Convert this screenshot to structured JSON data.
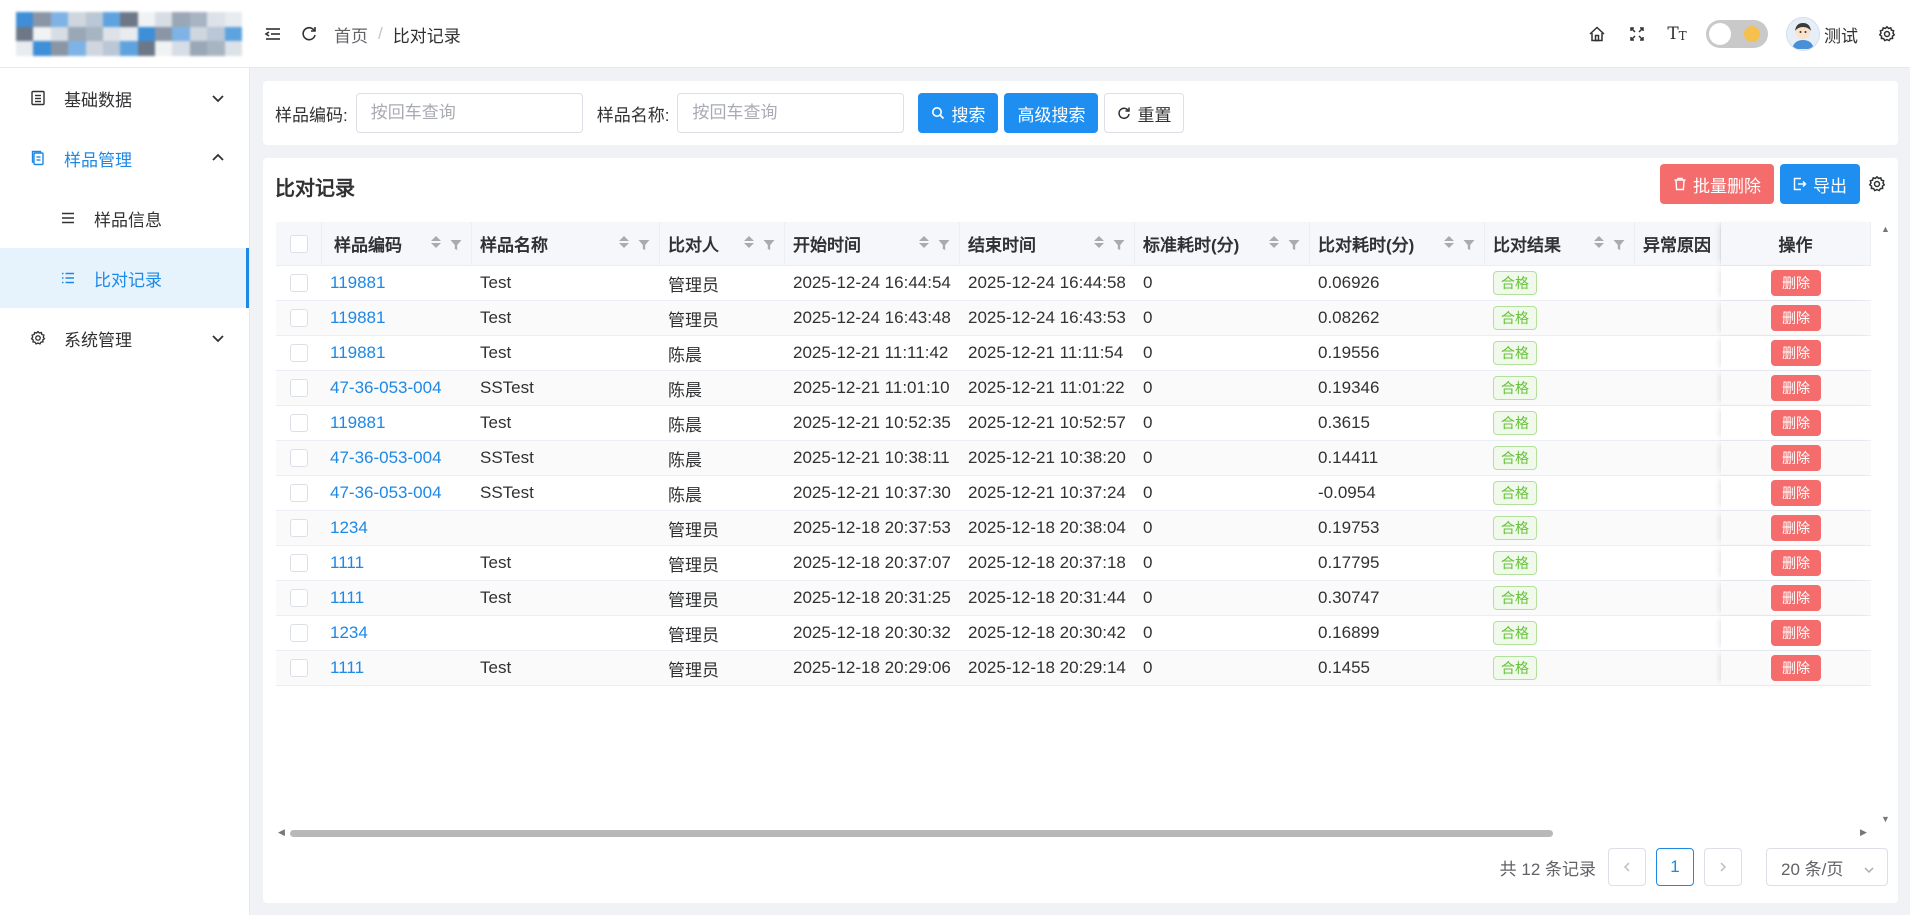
{
  "header": {
    "breadcrumb": [
      "首页",
      "比对记录"
    ],
    "breadcrumb_sep": "/",
    "user_name": "测试",
    "icons": [
      "menu-fold-icon",
      "refresh-icon",
      "home-icon",
      "fullscreen-icon",
      "font-size-icon",
      "theme-toggle",
      "settings-icon"
    ]
  },
  "sidebar": {
    "items": [
      {
        "label": "基础数据",
        "icon": "list-box-icon",
        "expanded": false
      },
      {
        "label": "样品管理",
        "icon": "document-copy-icon",
        "expanded": true,
        "children": [
          {
            "label": "样品信息",
            "icon": "menu-lines-icon"
          },
          {
            "label": "比对记录",
            "icon": "list-icon",
            "active": true
          }
        ]
      },
      {
        "label": "系统管理",
        "icon": "gear-icon",
        "expanded": false
      }
    ]
  },
  "search": {
    "code_label": "样品编码:",
    "code_placeholder": "按回车查询",
    "name_label": "样品名称:",
    "name_placeholder": "按回车查询",
    "search_btn": "搜索",
    "advanced_btn": "高级搜索",
    "reset_btn": "重置"
  },
  "table": {
    "title": "比对记录",
    "batch_delete_btn": "批量删除",
    "export_btn": "导出",
    "columns": [
      "样品编码",
      "样品名称",
      "比对人",
      "开始时间",
      "结束时间",
      "标准耗时(分)",
      "比对耗时(分)",
      "比对结果",
      "异常原因",
      "操作"
    ],
    "delete_label": "删除",
    "rows": [
      {
        "code": "119881",
        "name": "Test",
        "person": "管理员",
        "start": "2025-12-24 16:44:54",
        "end": "2025-12-24 16:44:58",
        "std": "0",
        "cmp": "0.06926",
        "result": "合格",
        "err": ""
      },
      {
        "code": "119881",
        "name": "Test",
        "person": "管理员",
        "start": "2025-12-24 16:43:48",
        "end": "2025-12-24 16:43:53",
        "std": "0",
        "cmp": "0.08262",
        "result": "合格",
        "err": ""
      },
      {
        "code": "119881",
        "name": "Test",
        "person": "陈晨",
        "start": "2025-12-21 11:11:42",
        "end": "2025-12-21 11:11:54",
        "std": "0",
        "cmp": "0.19556",
        "result": "合格",
        "err": ""
      },
      {
        "code": "47-36-053-004",
        "name": "SSTest",
        "person": "陈晨",
        "start": "2025-12-21 11:01:10",
        "end": "2025-12-21 11:01:22",
        "std": "0",
        "cmp": "0.19346",
        "result": "合格",
        "err": ""
      },
      {
        "code": "119881",
        "name": "Test",
        "person": "陈晨",
        "start": "2025-12-21 10:52:35",
        "end": "2025-12-21 10:52:57",
        "std": "0",
        "cmp": "0.3615",
        "result": "合格",
        "err": ""
      },
      {
        "code": "47-36-053-004",
        "name": "SSTest",
        "person": "陈晨",
        "start": "2025-12-21 10:38:11",
        "end": "2025-12-21 10:38:20",
        "std": "0",
        "cmp": "0.14411",
        "result": "合格",
        "err": ""
      },
      {
        "code": "47-36-053-004",
        "name": "SSTest",
        "person": "陈晨",
        "start": "2025-12-21 10:37:30",
        "end": "2025-12-21 10:37:24",
        "std": "0",
        "cmp": "-0.0954",
        "result": "合格",
        "err": ""
      },
      {
        "code": "1234",
        "name": "",
        "person": "管理员",
        "start": "2025-12-18 20:37:53",
        "end": "2025-12-18 20:38:04",
        "std": "0",
        "cmp": "0.19753",
        "result": "合格",
        "err": ""
      },
      {
        "code": "1111",
        "name": "Test",
        "person": "管理员",
        "start": "2025-12-18 20:37:07",
        "end": "2025-12-18 20:37:18",
        "std": "0",
        "cmp": "0.17795",
        "result": "合格",
        "err": ""
      },
      {
        "code": "1111",
        "name": "Test",
        "person": "管理员",
        "start": "2025-12-18 20:31:25",
        "end": "2025-12-18 20:31:44",
        "std": "0",
        "cmp": "0.30747",
        "result": "合格",
        "err": ""
      },
      {
        "code": "1234",
        "name": "",
        "person": "管理员",
        "start": "2025-12-18 20:30:32",
        "end": "2025-12-18 20:30:42",
        "std": "0",
        "cmp": "0.16899",
        "result": "合格",
        "err": ""
      },
      {
        "code": "1111",
        "name": "Test",
        "person": "管理员",
        "start": "2025-12-18 20:29:06",
        "end": "2025-12-18 20:29:14",
        "std": "0",
        "cmp": "0.1455",
        "result": "合格",
        "err": ""
      }
    ]
  },
  "pagination": {
    "total_text": "共 12 条记录",
    "current_page": "1",
    "page_size": "20 条/页"
  },
  "colors": {
    "primary": "#1e8ef0",
    "danger": "#f56c6c",
    "success": "#67c23a",
    "link": "#1e88e5"
  }
}
